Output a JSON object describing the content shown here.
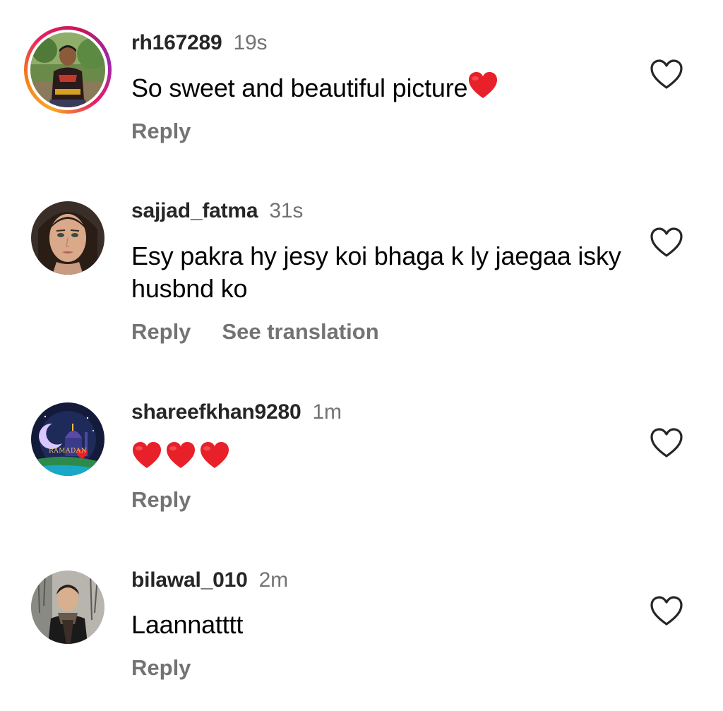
{
  "comments": [
    {
      "username": "rh167289",
      "time": "19s",
      "text": "So sweet and beautiful picture",
      "emoji": [
        "red-heart"
      ],
      "actions": [
        "Reply"
      ],
      "has_story_ring": true,
      "avatar": "man-in-sports-jersey-outdoors"
    },
    {
      "username": "sajjad_fatma",
      "time": "31s",
      "text": "Esy pakra hy jesy koi bhaga k ly jaegaa isky husbnd ko",
      "emoji": [],
      "actions": [
        "Reply",
        "See translation"
      ],
      "has_story_ring": false,
      "avatar": "woman-portrait"
    },
    {
      "username": "shareefkhan9280",
      "time": "1m",
      "text": "",
      "emoji": [
        "red-heart",
        "red-heart",
        "red-heart"
      ],
      "actions": [
        "Reply"
      ],
      "has_story_ring": false,
      "avatar": "ramadan-mosque-illustration",
      "avatar_caption": "RAMADAN"
    },
    {
      "username": "bilawal_010",
      "time": "2m",
      "text": "Laannatttt",
      "emoji": [],
      "actions": [
        "Reply"
      ],
      "has_story_ring": false,
      "avatar": "man-with-scarf-winter"
    }
  ],
  "colors": {
    "username": "#262626",
    "secondary": "#737373",
    "text": "#000000",
    "emoji_heart": "#e8202a"
  },
  "like_icon": "heart-outline-icon"
}
